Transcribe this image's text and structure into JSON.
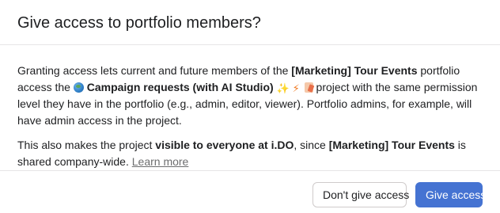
{
  "dialog": {
    "title": "Give access to portfolio members?"
  },
  "paragraph1": {
    "text_a": "Granting access lets current and future members of the ",
    "portfolio_name": "[Marketing] Tour Events",
    "text_b": " portfolio access the ",
    "project_name": "Campaign requests (with AI Studio)",
    "text_c": " project with the same permission level they have in the portfolio (e.g., admin, editor, viewer). Portfolio admins, for example, will have admin access in the project.",
    "icons": [
      "globe-icon",
      "sparkles-icon",
      "lightning-icon",
      "page-icon"
    ]
  },
  "paragraph2": {
    "text_a": "This also makes the project ",
    "visibility": "visible to everyone at i.DO",
    "text_b": ", since ",
    "portfolio_name": "[Marketing] Tour Events",
    "text_c": " is shared company-wide. ",
    "learn_more": "Learn more"
  },
  "footer": {
    "secondary_label": "Don't give access",
    "primary_label": "Give access"
  },
  "colors": {
    "primary": "#4573d2",
    "text": "#1e1f21",
    "muted": "#6d6e6f",
    "border": "#e6e5e6"
  }
}
